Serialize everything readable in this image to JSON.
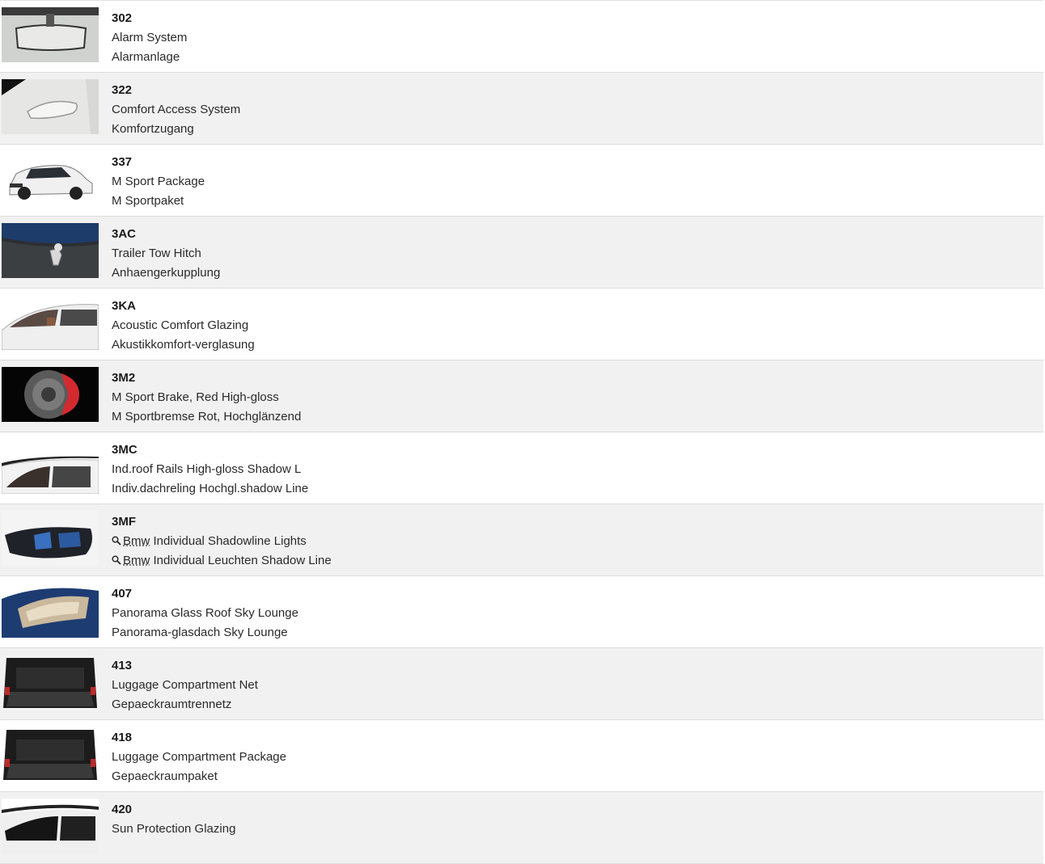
{
  "items": [
    {
      "code": "302",
      "en": "Alarm System",
      "de": "Alarmanlage",
      "thumb": "mirror-image"
    },
    {
      "code": "322",
      "en": "Comfort Access System",
      "de": "Komfortzugang",
      "thumb": "door-handle-image"
    },
    {
      "code": "337",
      "en": "M Sport Package",
      "de": "M Sportpaket",
      "thumb": "white-suv-image"
    },
    {
      "code": "3AC",
      "en": "Trailer Tow Hitch",
      "de": "Anhaengerkupplung",
      "thumb": "tow-hitch-image"
    },
    {
      "code": "3KA",
      "en": "Acoustic Comfort Glazing",
      "de": "Akustikkomfort-verglasung",
      "thumb": "side-window-image"
    },
    {
      "code": "3M2",
      "en": "M Sport Brake, Red High-gloss",
      "de": "M Sportbremse Rot, Hochglänzend",
      "thumb": "red-brake-image"
    },
    {
      "code": "3MC",
      "en": "Ind.roof Rails High-gloss Shadow L",
      "de": "Indiv.dachreling Hochgl.shadow Line",
      "thumb": "roof-rail-image"
    },
    {
      "code": "3MF",
      "en_prefix": "Bmw",
      "en": "Individual Shadowline Lights",
      "de_prefix": "Bmw",
      "de": "Individual Leuchten Shadow Line",
      "thumb": "headlight-image",
      "lookup_icon": "magnifier-icon"
    },
    {
      "code": "407",
      "en": "Panorama Glass Roof Sky Lounge",
      "de": "Panorama-glasdach Sky Lounge",
      "thumb": "panorama-roof-image"
    },
    {
      "code": "413",
      "en": "Luggage Compartment Net",
      "de": "Gepaeckraumtrennetz",
      "thumb": "trunk-net-image"
    },
    {
      "code": "418",
      "en": "Luggage Compartment Package",
      "de": "Gepaeckraumpaket",
      "thumb": "trunk-package-image"
    },
    {
      "code": "420",
      "en": "Sun Protection Glazing",
      "de": "",
      "thumb": "rear-glazing-image"
    }
  ]
}
